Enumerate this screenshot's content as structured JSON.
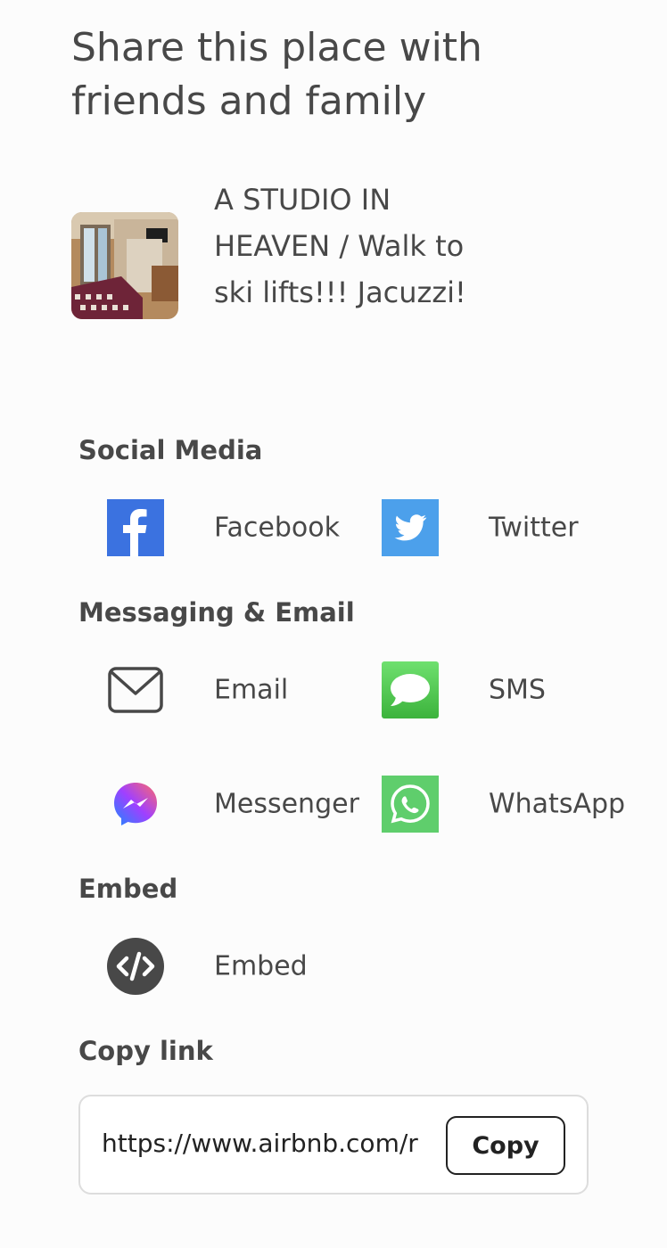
{
  "header": {
    "title": "Share this place with friends and family"
  },
  "listing": {
    "title": "A STUDIO IN HEAVEN / Walk to ski lifts!!! Jacuzzi!"
  },
  "sections": {
    "social": {
      "label": "Social Media",
      "items": [
        {
          "label": "Facebook",
          "icon": "facebook-icon",
          "color": "#3b5998"
        },
        {
          "label": "Twitter",
          "icon": "twitter-icon",
          "color": "#4ca0eb"
        }
      ]
    },
    "messaging": {
      "label": "Messaging & Email",
      "items": [
        {
          "label": "Email",
          "icon": "envelope-icon"
        },
        {
          "label": "SMS",
          "icon": "sms-bubble-icon",
          "color": "#4cd964"
        },
        {
          "label": "Messenger",
          "icon": "messenger-icon"
        },
        {
          "label": "WhatsApp",
          "icon": "whatsapp-icon",
          "color": "#5fce6c"
        }
      ]
    },
    "embed": {
      "label": "Embed",
      "items": [
        {
          "label": "Embed",
          "icon": "code-icon"
        }
      ]
    }
  },
  "copy_link": {
    "label": "Copy link",
    "url": "https://www.airbnb.com/r",
    "button_label": "Copy"
  }
}
